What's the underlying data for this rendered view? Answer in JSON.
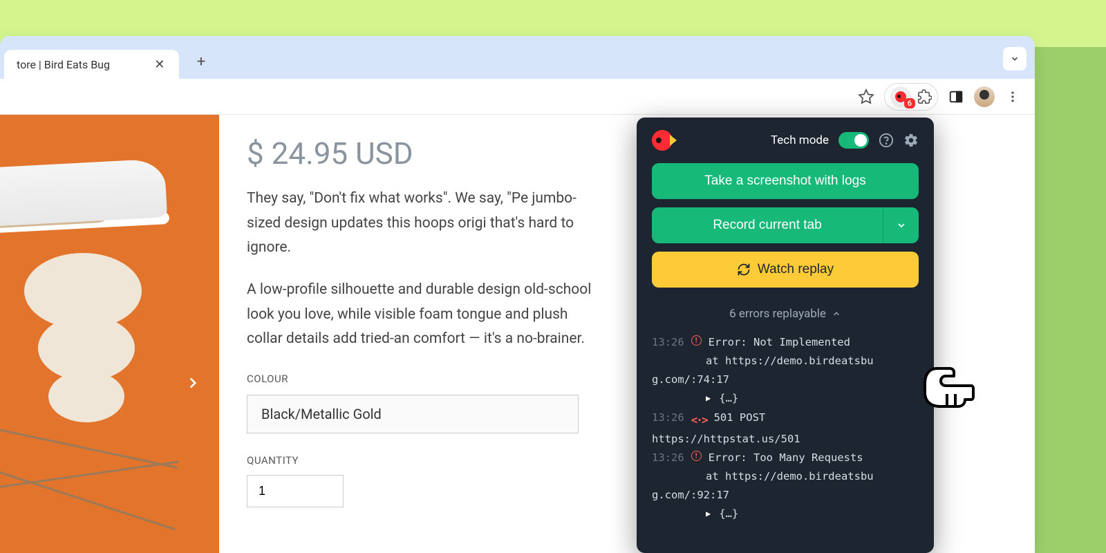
{
  "browser": {
    "tab_title": "tore | Bird Eats Bug",
    "extension_badge": "6"
  },
  "product": {
    "price": "$ 24.95 USD",
    "description_p1": "They say, \"Don't fix what works\". We say, \"Pe jumbo-sized design updates this hoops origi that's hard to ignore.",
    "description_p2": "A low-profile silhouette and durable design old-school look you love, while visible foam tongue and plush collar details add tried-an comfort — it's a no-brainer.",
    "colour_label": "COLOUR",
    "colour_value": "Black/Metallic Gold",
    "quantity_label": "QUANTITY",
    "quantity_value": "1"
  },
  "popup": {
    "tech_mode_label": "Tech mode",
    "screenshot_btn": "Take a screenshot with logs",
    "record_btn": "Record current tab",
    "replay_btn": "Watch replay",
    "errors_header": "6 errors replayable",
    "errors": [
      {
        "ts": "13:26",
        "type": "error",
        "line1": "Error: Not Implemented",
        "line2": "at https://demo.birdeatsbu",
        "line3": "g.com/:74:17",
        "expand": "{…}"
      },
      {
        "ts": "13:26",
        "type": "network",
        "line1": "501 POST",
        "line2": "https://httpstat.us/501"
      },
      {
        "ts": "13:26",
        "type": "error",
        "line1": "Error: Too Many Requests",
        "line2": "at https://demo.birdeatsbu",
        "line3": "g.com/:92:17",
        "expand": "{…}"
      }
    ]
  }
}
